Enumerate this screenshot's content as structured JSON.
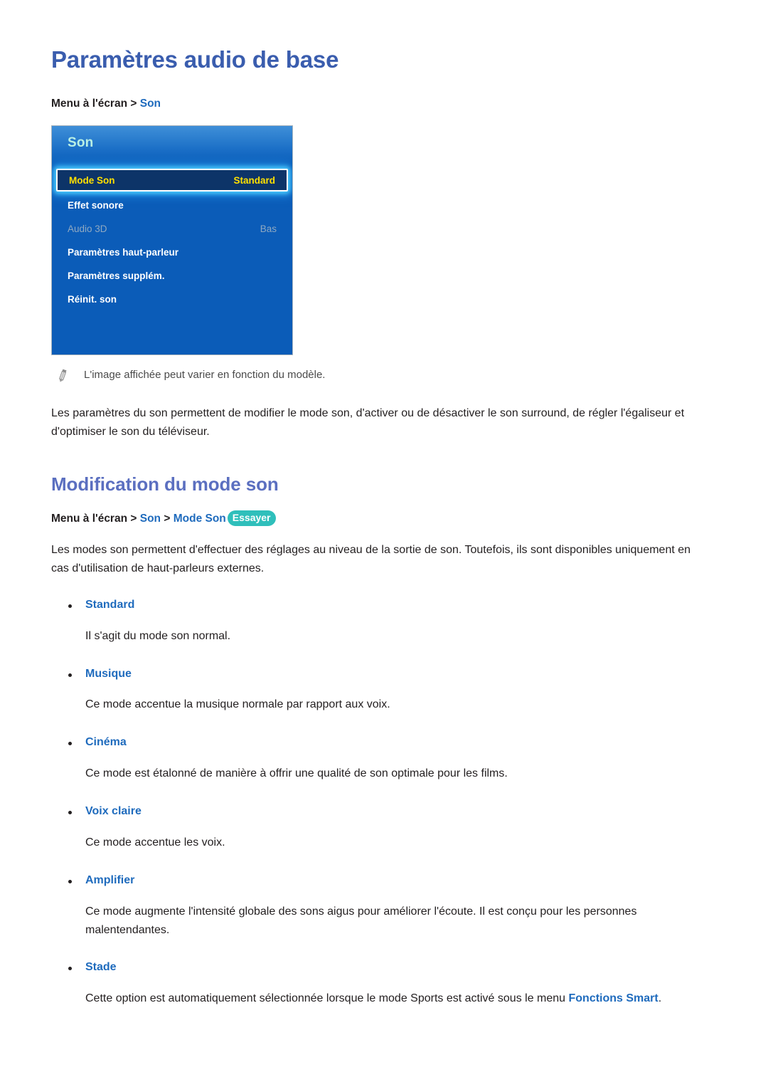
{
  "page": {
    "title": "Paramètres audio de base"
  },
  "menu_path_top": {
    "root": "Menu à l'écran",
    "separator": ">",
    "leaf": "Son"
  },
  "tv_menu": {
    "header_title": "Son",
    "rows": [
      {
        "label": "Mode Son",
        "value": "Standard",
        "state": "selected"
      },
      {
        "label": "Effet sonore",
        "value": "",
        "state": "normal"
      },
      {
        "label": "Audio 3D",
        "value": "Bas",
        "state": "disabled"
      },
      {
        "label": "Paramètres haut-parleur",
        "value": "",
        "state": "normal"
      },
      {
        "label": "Paramètres supplém.",
        "value": "",
        "state": "normal"
      },
      {
        "label": "Réinit. son",
        "value": "",
        "state": "normal"
      }
    ]
  },
  "note": {
    "icon": "pencil-icon",
    "text": "L'image affichée peut varier en fonction du modèle."
  },
  "intro_paragraph": "Les paramètres du son permettent de modifier le mode son, d'activer ou de désactiver le son surround, de régler l'égaliseur et d'optimiser le son du téléviseur.",
  "section": {
    "title": "Modification du mode son",
    "menu_path": {
      "root": "Menu à l'écran",
      "separator1": ">",
      "crumb1": "Son",
      "separator2": ">",
      "crumb2": "Mode Son",
      "badge": "Essayer"
    },
    "paragraph": "Les modes son permettent d'effectuer des réglages au niveau de la sortie de son. Toutefois, ils sont disponibles uniquement en cas d'utilisation de haut-parleurs externes.",
    "modes": [
      {
        "term": "Standard",
        "desc": "Il s'agit du mode son normal."
      },
      {
        "term": "Musique",
        "desc": "Ce mode accentue la musique normale par rapport aux voix."
      },
      {
        "term": "Cinéma",
        "desc": "Ce mode est étalonné de manière à offrir une qualité de son optimale pour les films."
      },
      {
        "term": "Voix claire",
        "desc": "Ce mode accentue les voix."
      },
      {
        "term": "Amplifier",
        "desc": "Ce mode augmente l'intensité globale des sons aigus pour améliorer l'écoute. Il est conçu pour les personnes malentendantes."
      },
      {
        "term": "Stade",
        "desc_before": "Cette option est automatiquement sélectionnée lorsque le mode Sports est activé sous le menu ",
        "desc_link": "Fonctions Smart",
        "desc_after": "."
      }
    ]
  },
  "colors": {
    "page_title": "#3a5dae",
    "section_title": "#5b6fc0",
    "link_blue": "#1f6bbd",
    "badge_teal": "#2fbfbb",
    "tv_blue": "#0b5cb8",
    "tv_selected_bg": "#0d3468",
    "tv_selected_text": "#ffe000",
    "tv_header_text": "#b9f0e4",
    "tv_disabled_text": "#8fa9c2",
    "body_text": "#231f20"
  }
}
